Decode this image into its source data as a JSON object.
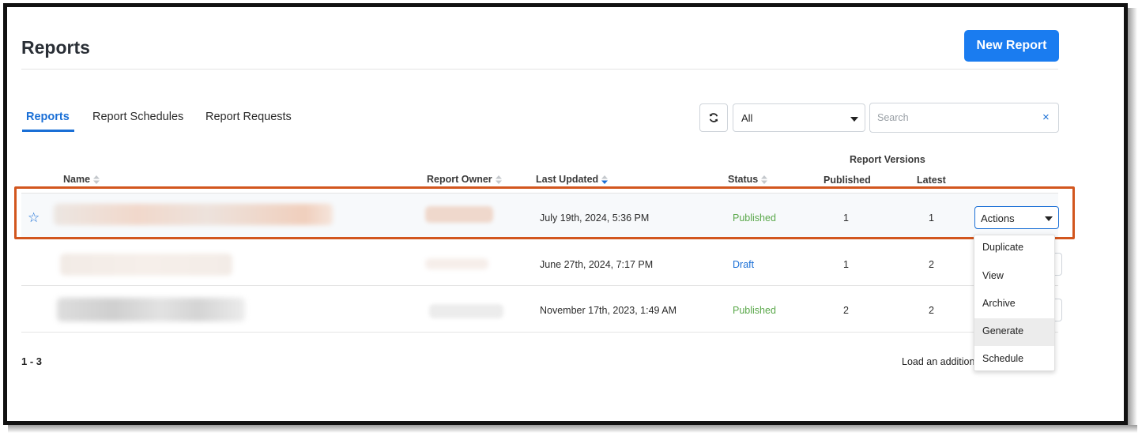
{
  "page": {
    "title": "Reports"
  },
  "header": {
    "new_report_label": "New Report"
  },
  "tabs": [
    {
      "label": "Reports",
      "active": true
    },
    {
      "label": "Report Schedules",
      "active": false
    },
    {
      "label": "Report Requests",
      "active": false
    }
  ],
  "toolbar": {
    "refresh_icon": "refresh-icon",
    "filter_value": "All",
    "search_placeholder": "Search",
    "search_value": "",
    "clear_label": "×"
  },
  "table": {
    "group_header": "Report Versions",
    "columns": {
      "name": "Name",
      "owner": "Report Owner",
      "updated": "Last Updated",
      "status": "Status",
      "published": "Published",
      "latest": "Latest"
    },
    "rows": [
      {
        "last_updated": "July 19th, 2024, 5:36 PM",
        "status": "Published",
        "published": "1",
        "latest": "1",
        "starred": true
      },
      {
        "last_updated": "June 27th, 2024, 7:17 PM",
        "status": "Draft",
        "published": "1",
        "latest": "2",
        "starred": false
      },
      {
        "last_updated": "November 17th, 2023, 1:49 AM",
        "status": "Published",
        "published": "2",
        "latest": "2",
        "starred": false
      }
    ],
    "actions_label": "Actions"
  },
  "actions_menu": {
    "items": [
      "Duplicate",
      "View",
      "Archive",
      "Generate",
      "Schedule"
    ],
    "hovered": "Generate"
  },
  "footer": {
    "range": "1 - 3",
    "load_more": "Load an additional"
  },
  "colors": {
    "accent": "#1a7cf0",
    "link": "#1a6fd6",
    "published": "#5aa84a",
    "highlight_border": "#d2561e"
  }
}
